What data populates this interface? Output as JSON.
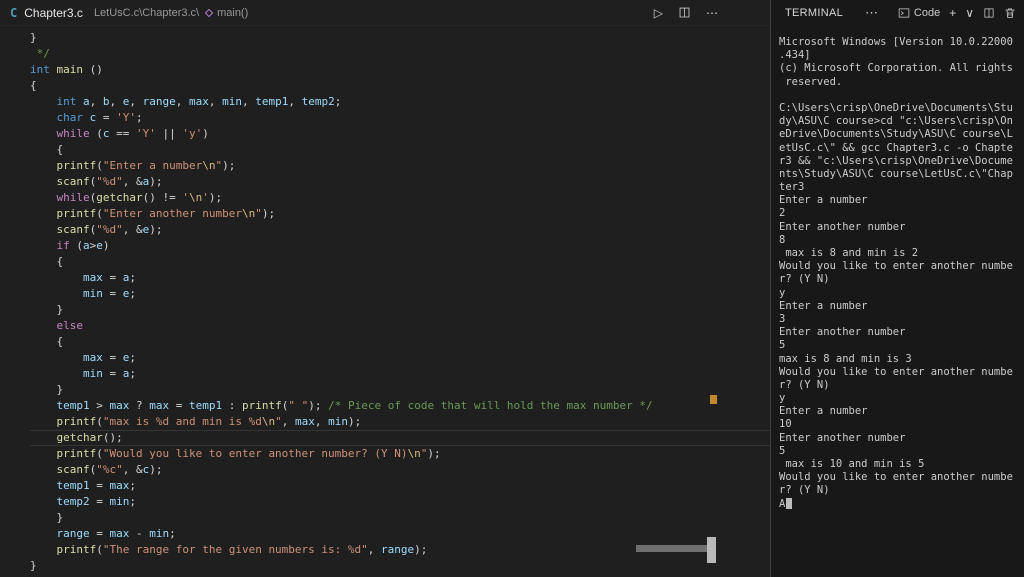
{
  "topbar": {
    "file_icon_letter": "C",
    "file_name": "Chapter3.c",
    "breadcrumb_path": "LetUsC.c\\Chapter3.c\\",
    "breadcrumb_symbol": "main()",
    "run_icon": "▷",
    "more_icon": "⋯"
  },
  "terminal_header": {
    "title": "TERMINAL",
    "more_icon": "⋯",
    "shell_name": "Code",
    "new_icon": "+",
    "dropdown_icon": "∨"
  },
  "colors": {
    "keyword": "#569cd6",
    "control": "#c586c0",
    "function": "#dcdcaa",
    "variable": "#9cdcfe",
    "string": "#ce9178",
    "escape": "#d7ba7d",
    "comment": "#6a9955",
    "punctuation": "#d4d4d4",
    "file_icon": "#519aba",
    "overview_marker": "#c08a2d"
  },
  "editor": {
    "current_line_index": 25,
    "code_lines": [
      [
        [
          "pun",
          "}"
        ]
      ],
      [
        [
          "cmt",
          " */"
        ]
      ],
      [
        [
          "kw",
          "int"
        ],
        [
          "pun",
          " "
        ],
        [
          "fn",
          "main"
        ],
        [
          "pun",
          " ()"
        ]
      ],
      [
        [
          "pun",
          "{"
        ]
      ],
      [
        [
          "pun",
          "    "
        ],
        [
          "kw",
          "int"
        ],
        [
          "pun",
          " "
        ],
        [
          "var",
          "a"
        ],
        [
          "pun",
          ", "
        ],
        [
          "var",
          "b"
        ],
        [
          "pun",
          ", "
        ],
        [
          "var",
          "e"
        ],
        [
          "pun",
          ", "
        ],
        [
          "var",
          "range"
        ],
        [
          "pun",
          ", "
        ],
        [
          "var",
          "max"
        ],
        [
          "pun",
          ", "
        ],
        [
          "var",
          "min"
        ],
        [
          "pun",
          ", "
        ],
        [
          "var",
          "temp1"
        ],
        [
          "pun",
          ", "
        ],
        [
          "var",
          "temp2"
        ],
        [
          "pun",
          ";"
        ]
      ],
      [
        [
          "pun",
          "    "
        ],
        [
          "kw",
          "char"
        ],
        [
          "pun",
          " "
        ],
        [
          "var",
          "c"
        ],
        [
          "pun",
          " = "
        ],
        [
          "str",
          "'Y'"
        ],
        [
          "pun",
          ";"
        ]
      ],
      [
        [
          "pun",
          "    "
        ],
        [
          "ctrl",
          "while"
        ],
        [
          "pun",
          " ("
        ],
        [
          "var",
          "c"
        ],
        [
          "pun",
          " == "
        ],
        [
          "str",
          "'Y'"
        ],
        [
          "pun",
          " || "
        ],
        [
          "str",
          "'y'"
        ],
        [
          "pun",
          ")"
        ]
      ],
      [
        [
          "pun",
          "    {"
        ]
      ],
      [
        [
          "pun",
          "    "
        ],
        [
          "fn",
          "printf"
        ],
        [
          "pun",
          "("
        ],
        [
          "str",
          "\"Enter a number"
        ],
        [
          "esc",
          "\\n"
        ],
        [
          "str",
          "\""
        ],
        [
          "pun",
          ");"
        ]
      ],
      [
        [
          "pun",
          "    "
        ],
        [
          "fn",
          "scanf"
        ],
        [
          "pun",
          "("
        ],
        [
          "str",
          "\"%d\""
        ],
        [
          "pun",
          ", &"
        ],
        [
          "var",
          "a"
        ],
        [
          "pun",
          ");"
        ]
      ],
      [
        [
          "pun",
          "    "
        ],
        [
          "ctrl",
          "while"
        ],
        [
          "pun",
          "("
        ],
        [
          "fn",
          "getchar"
        ],
        [
          "pun",
          "() != "
        ],
        [
          "str",
          "'"
        ],
        [
          "esc",
          "\\n"
        ],
        [
          "str",
          "'"
        ],
        [
          "pun",
          ");"
        ]
      ],
      [
        [
          "pun",
          "    "
        ],
        [
          "fn",
          "printf"
        ],
        [
          "pun",
          "("
        ],
        [
          "str",
          "\"Enter another number"
        ],
        [
          "esc",
          "\\n"
        ],
        [
          "str",
          "\""
        ],
        [
          "pun",
          ");"
        ]
      ],
      [
        [
          "pun",
          "    "
        ],
        [
          "fn",
          "scanf"
        ],
        [
          "pun",
          "("
        ],
        [
          "str",
          "\"%d\""
        ],
        [
          "pun",
          ", &"
        ],
        [
          "var",
          "e"
        ],
        [
          "pun",
          ");"
        ]
      ],
      [
        [
          "pun",
          "    "
        ],
        [
          "ctrl",
          "if"
        ],
        [
          "pun",
          " ("
        ],
        [
          "var",
          "a"
        ],
        [
          "pun",
          ">"
        ],
        [
          "var",
          "e"
        ],
        [
          "pun",
          ")"
        ]
      ],
      [
        [
          "pun",
          "    {"
        ]
      ],
      [
        [
          "pun",
          "        "
        ],
        [
          "var",
          "max"
        ],
        [
          "pun",
          " = "
        ],
        [
          "var",
          "a"
        ],
        [
          "pun",
          ";"
        ]
      ],
      [
        [
          "pun",
          "        "
        ],
        [
          "var",
          "min"
        ],
        [
          "pun",
          " = "
        ],
        [
          "var",
          "e"
        ],
        [
          "pun",
          ";"
        ]
      ],
      [
        [
          "pun",
          "    }"
        ]
      ],
      [
        [
          "pun",
          "    "
        ],
        [
          "ctrl",
          "else"
        ]
      ],
      [
        [
          "pun",
          "    {"
        ]
      ],
      [
        [
          "pun",
          "        "
        ],
        [
          "var",
          "max"
        ],
        [
          "pun",
          " = "
        ],
        [
          "var",
          "e"
        ],
        [
          "pun",
          ";"
        ]
      ],
      [
        [
          "pun",
          "        "
        ],
        [
          "var",
          "min"
        ],
        [
          "pun",
          " = "
        ],
        [
          "var",
          "a"
        ],
        [
          "pun",
          ";"
        ]
      ],
      [
        [
          "pun",
          "    }"
        ]
      ],
      [
        [
          "pun",
          "    "
        ],
        [
          "var",
          "temp1"
        ],
        [
          "pun",
          " > "
        ],
        [
          "var",
          "max"
        ],
        [
          "pun",
          " ? "
        ],
        [
          "var",
          "max"
        ],
        [
          "pun",
          " = "
        ],
        [
          "var",
          "temp1"
        ],
        [
          "pun",
          " : "
        ],
        [
          "fn",
          "printf"
        ],
        [
          "pun",
          "("
        ],
        [
          "str",
          "\" \""
        ],
        [
          "pun",
          "); "
        ],
        [
          "cmt",
          "/* Piece of code that will hold the max number */"
        ]
      ],
      [
        [
          "pun",
          "    "
        ],
        [
          "fn",
          "printf"
        ],
        [
          "pun",
          "("
        ],
        [
          "str",
          "\"max is %d and min is %d"
        ],
        [
          "esc",
          "\\n"
        ],
        [
          "str",
          "\""
        ],
        [
          "pun",
          ", "
        ],
        [
          "var",
          "max"
        ],
        [
          "pun",
          ", "
        ],
        [
          "var",
          "min"
        ],
        [
          "pun",
          ");"
        ]
      ],
      [
        [
          "pun",
          "    "
        ],
        [
          "fn",
          "getchar"
        ],
        [
          "pun",
          "();"
        ]
      ],
      [
        [
          "pun",
          "    "
        ],
        [
          "fn",
          "printf"
        ],
        [
          "pun",
          "("
        ],
        [
          "str",
          "\"Would you like to enter another number? (Y N)"
        ],
        [
          "esc",
          "\\n"
        ],
        [
          "str",
          "\""
        ],
        [
          "pun",
          ");"
        ]
      ],
      [
        [
          "pun",
          "    "
        ],
        [
          "fn",
          "scanf"
        ],
        [
          "pun",
          "("
        ],
        [
          "str",
          "\"%c\""
        ],
        [
          "pun",
          ", &"
        ],
        [
          "var",
          "c"
        ],
        [
          "pun",
          ");"
        ]
      ],
      [
        [
          "pun",
          "    "
        ],
        [
          "var",
          "temp1"
        ],
        [
          "pun",
          " = "
        ],
        [
          "var",
          "max"
        ],
        [
          "pun",
          ";"
        ]
      ],
      [
        [
          "pun",
          "    "
        ],
        [
          "var",
          "temp2"
        ],
        [
          "pun",
          " = "
        ],
        [
          "var",
          "min"
        ],
        [
          "pun",
          ";"
        ]
      ],
      [
        [
          "pun",
          "    }"
        ]
      ],
      [
        [
          "pun",
          "    "
        ],
        [
          "var",
          "range"
        ],
        [
          "pun",
          " = "
        ],
        [
          "var",
          "max"
        ],
        [
          "pun",
          " - "
        ],
        [
          "var",
          "min"
        ],
        [
          "pun",
          ";"
        ]
      ],
      [
        [
          "pun",
          "    "
        ],
        [
          "fn",
          "printf"
        ],
        [
          "pun",
          "("
        ],
        [
          "str",
          "\"The range for the given numbers is: %d\""
        ],
        [
          "pun",
          ", "
        ],
        [
          "var",
          "range"
        ],
        [
          "pun",
          ");"
        ]
      ],
      [
        [
          "pun",
          "}"
        ]
      ]
    ]
  },
  "terminal": {
    "cursor_visible": true,
    "lines": [
      "Microsoft Windows [Version 10.0.22000",
      ".434]",
      "(c) Microsoft Corporation. All rights",
      " reserved.",
      "",
      "C:\\Users\\crisp\\OneDrive\\Documents\\Stu",
      "dy\\ASU\\C course>cd \"c:\\Users\\crisp\\On",
      "eDrive\\Documents\\Study\\ASU\\C course\\L",
      "etUsC.c\\\" && gcc Chapter3.c -o Chapte",
      "r3 && \"c:\\Users\\crisp\\OneDrive\\Docume",
      "nts\\Study\\ASU\\C course\\LetUsC.c\\\"Chap",
      "ter3",
      "Enter a number",
      "2",
      "Enter another number",
      "8",
      " max is 8 and min is 2",
      "Would you like to enter another numbe",
      "r? (Y N)",
      "y",
      "Enter a number",
      "3",
      "Enter another number",
      "5",
      "max is 8 and min is 3",
      "Would you like to enter another numbe",
      "r? (Y N)",
      "y",
      "Enter a number",
      "10",
      "Enter another number",
      "5",
      " max is 10 and min is 5",
      "Would you like to enter another numbe",
      "r? (Y N)",
      "A"
    ]
  }
}
